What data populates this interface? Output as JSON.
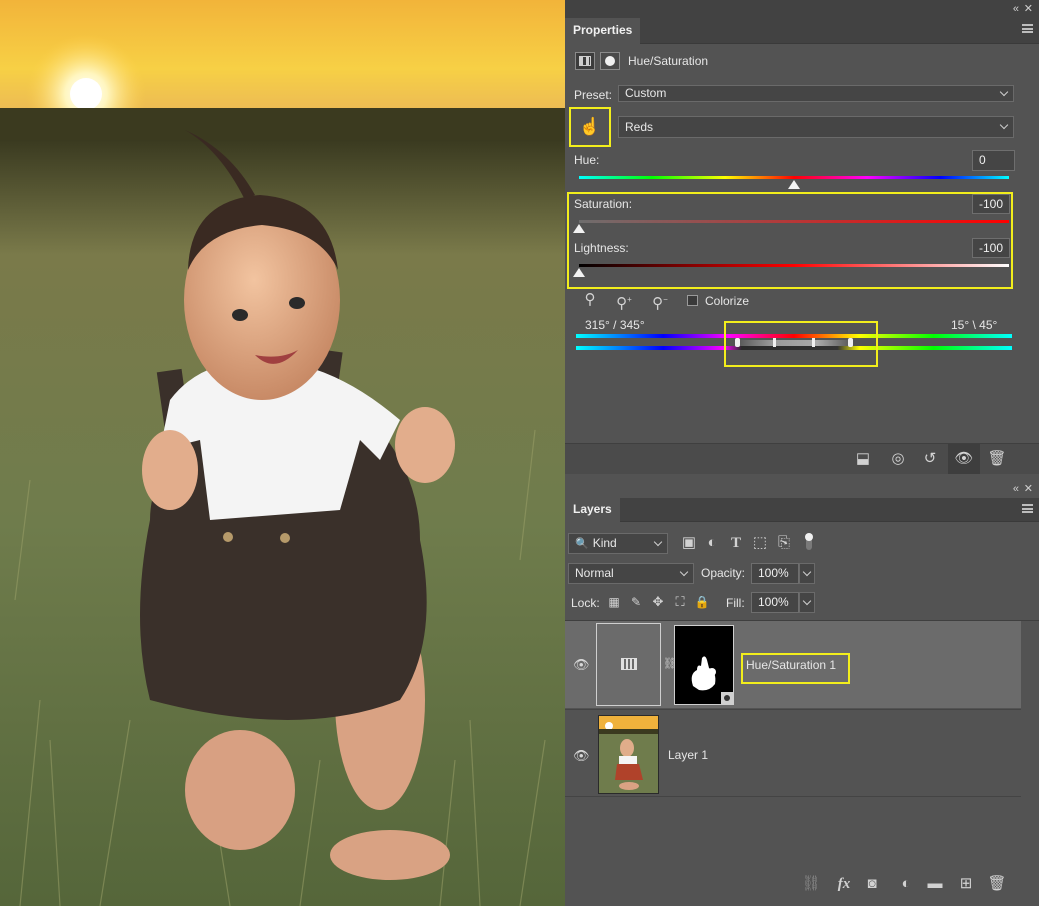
{
  "properties": {
    "tab_label": "Properties",
    "adjustment_name": "Hue/Saturation",
    "preset_label": "Preset:",
    "preset_value": "Custom",
    "channel_value": "Reds",
    "hue_label": "Hue:",
    "hue_value": "0",
    "saturation_label": "Saturation:",
    "saturation_value": "-100",
    "lightness_label": "Lightness:",
    "lightness_value": "-100",
    "colorize_label": "Colorize",
    "colorize_checked": false,
    "range_left": "315° / 345°",
    "range_right": "15° \\ 45°"
  },
  "layers": {
    "tab_label": "Layers",
    "filter_kind": "Kind",
    "blend_mode": "Normal",
    "opacity_label": "Opacity:",
    "opacity_value": "100%",
    "lock_label": "Lock:",
    "fill_label": "Fill:",
    "fill_value": "100%",
    "items": [
      {
        "name": "Hue/Saturation 1"
      },
      {
        "name": "Layer 1"
      }
    ]
  },
  "colors": {
    "panel_bg": "#535353",
    "panel_header": "#424242",
    "highlight": "#f2ee1c"
  }
}
